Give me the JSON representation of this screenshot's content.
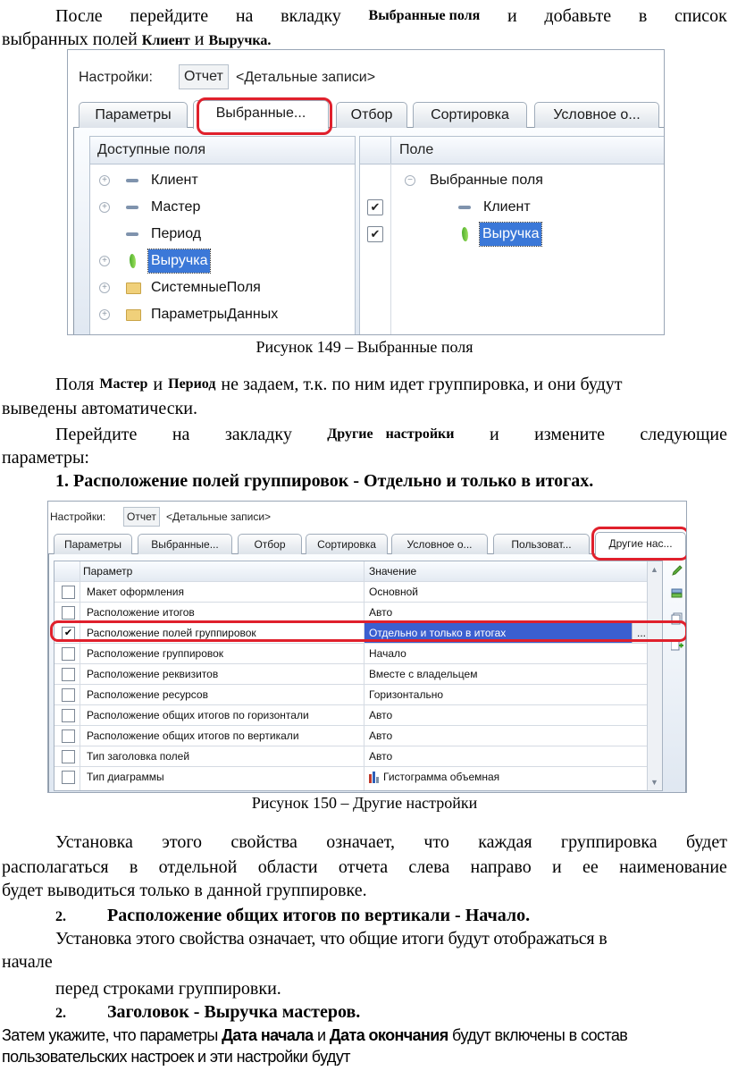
{
  "para1": {
    "line1_words": [
      "После",
      "перейдите",
      "на",
      "вкладку"
    ],
    "tab_name": "Выбранные поля",
    "line1_tail": [
      "и",
      "добавьте",
      "в",
      "список"
    ],
    "line2_start": "выбранных полей",
    "field1": "Клиент",
    "conj": "и",
    "field2": "Выручка."
  },
  "fig1": {
    "settings_label": "Настройки:",
    "settings_value": "Отчет",
    "settings_variant": "<Детальные записи>",
    "tabs": [
      "Параметры",
      "Выбранные...",
      "Отбор",
      "Сортировка",
      "Условное о..."
    ],
    "left_header": "Доступные поля",
    "left_items": [
      "Клиент",
      "Мастер",
      "Период",
      "Выручка",
      "СистемныеПоля",
      "ПараметрыДанных"
    ],
    "right_header": "Поле",
    "right_root": "Выбранные поля",
    "right_items": [
      "Клиент",
      "Выручка"
    ],
    "caption": "Рисунок 149 – Выбранные поля"
  },
  "para2": {
    "t1": "Поля",
    "w1": "Мастер",
    "t2": "и",
    "w2": "Период",
    "t3": "не задаем, т.к. по ним идет группировка, и они будут",
    "line2": "выведены автоматически.",
    "line3_words": [
      "Перейдите",
      "на",
      "закладку"
    ],
    "line3_bold": "Другие настройки",
    "line3_tail": [
      "и",
      "измените",
      "следующие"
    ],
    "line4": "параметры:",
    "item1": "1. Расположение полей группировок - Отдельно и только в итогах."
  },
  "fig2": {
    "settings_label": "Настройки:",
    "settings_value": "Отчет",
    "settings_variant": "<Детальные записи>",
    "tabs": [
      "Параметры",
      "Выбранные...",
      "Отбор",
      "Сортировка",
      "Условное о...",
      "Пользоват...",
      "Другие нас..."
    ],
    "col_param": "Параметр",
    "col_value": "Значение",
    "rows": [
      {
        "param": "Макет оформления",
        "value": "Основной",
        "checked": ""
      },
      {
        "param": "Расположение итогов",
        "value": "Авто",
        "checked": ""
      },
      {
        "param": "Расположение полей группировок",
        "value": "Отдельно и только в итогах",
        "checked": "✔"
      },
      {
        "param": "Расположение группировок",
        "value": "Начало",
        "checked": ""
      },
      {
        "param": "Расположение реквизитов",
        "value": "Вместе с владельцем",
        "checked": ""
      },
      {
        "param": "Расположение ресурсов",
        "value": "Горизонтально",
        "checked": ""
      },
      {
        "param": "Расположение общих итогов по горизонтали",
        "value": "Авто",
        "checked": ""
      },
      {
        "param": "Расположение общих итогов по вертикали",
        "value": "Авто",
        "checked": ""
      },
      {
        "param": "Тип заголовка полей",
        "value": "Авто",
        "checked": ""
      },
      {
        "param": "Тип диаграммы",
        "value": "Гистограмма объемная",
        "checked": ""
      }
    ],
    "ellipsis": "...",
    "caption": "Рисунок 150 – Другие настройки"
  },
  "para3": {
    "line1_words": [
      "Установка",
      "этого",
      "свойства",
      "означает,",
      "что",
      "каждая",
      "группировка",
      "будет"
    ],
    "line2_words": [
      "располагаться",
      "в",
      "отдельной",
      "области",
      "отчета",
      "слева",
      "направо",
      "и",
      "ее",
      "наименование"
    ],
    "line3": "будет выводиться только в данной группировке.",
    "item2_num": "2.",
    "item2": "Расположение общих итогов по вертикали - Начало.",
    "line4": "Установка этого свойства означает, что общие итоги будут отображаться в",
    "line5": "начале",
    "line6": "перед строками группировки.",
    "item3_num": "2.",
    "item3": "Заголовок - Выручка мастеров.",
    "last1_a": "Затем укажите, что параметры",
    "last1_b": "Дата начала",
    "last1_c": "и",
    "last1_d": "Дата окончания",
    "last1_e": "будут включены в состав",
    "last2": "пользовательских настроек и эти настройки будут"
  }
}
